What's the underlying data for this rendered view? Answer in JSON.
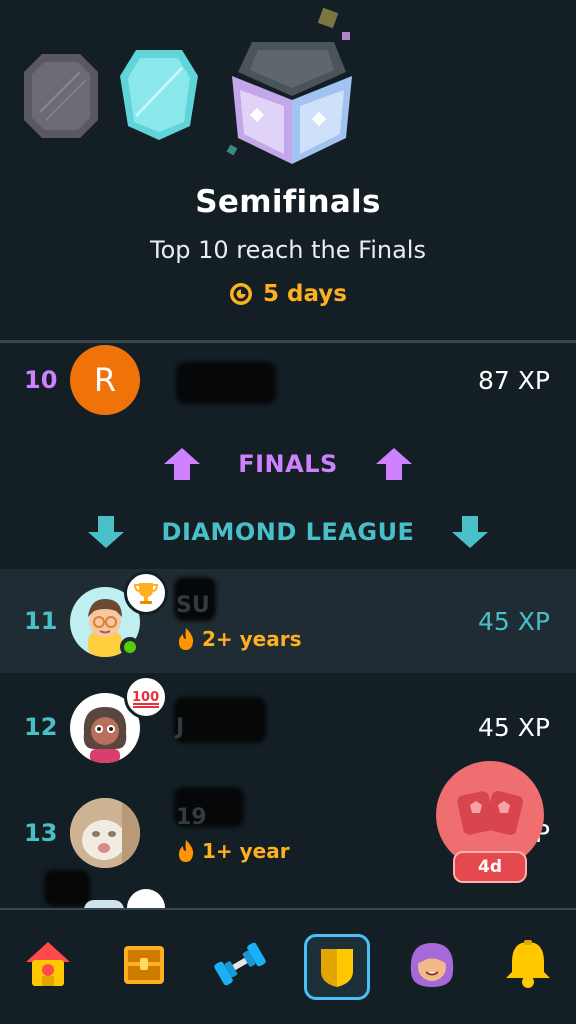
{
  "league": {
    "title": "Semifinals",
    "subtitle": "Top 10 reach the Finals",
    "time_left": "5 days"
  },
  "zones": {
    "promotion_label": "FINALS",
    "demotion_label": "DIAMOND LEAGUE"
  },
  "leaderboard": [
    {
      "rank": "10",
      "avatar_letter": "R",
      "name_visible": "",
      "xp": "87 XP",
      "rank_color": "#ce82ff",
      "streak": ""
    },
    {
      "rank": "11",
      "name_visible": "SU",
      "xp": "45 XP",
      "rank_color": "#49c0c8",
      "streak": "2+ years",
      "badge": "trophy-icon"
    },
    {
      "rank": "12",
      "name_visible": "J",
      "xp": "45 XP",
      "rank_color": "#49c0c8",
      "streak": "",
      "badge": "hundred-icon"
    },
    {
      "rank": "13",
      "name_visible": "19",
      "xp": "P",
      "rank_color": "#49c0c8",
      "streak": "1+ year"
    }
  ],
  "chest": {
    "label": "4d"
  },
  "nav": {
    "items": [
      "home-icon",
      "chest-icon",
      "dumbbell-icon",
      "shield-icon",
      "profile-icon",
      "bell-icon"
    ],
    "active": "shield-icon"
  },
  "colors": {
    "background": "#131f24",
    "highlight_row": "#1f2c33",
    "promotion": "#ce82ff",
    "demotion": "#49c0c8",
    "streak": "#ffb020"
  }
}
